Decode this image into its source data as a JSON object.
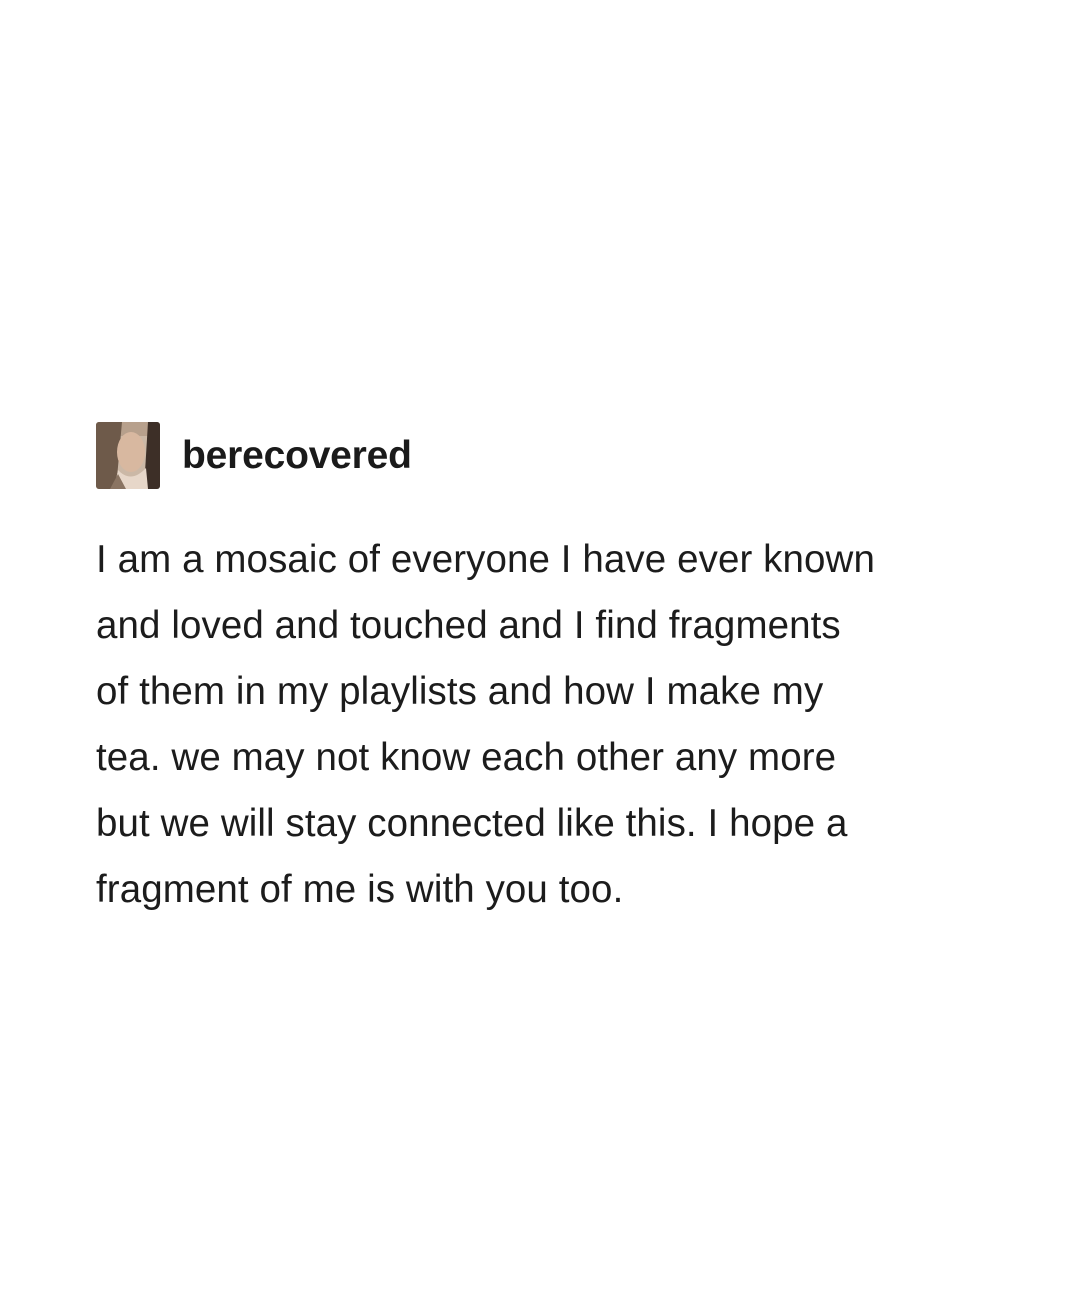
{
  "post": {
    "username": "berecovered",
    "avatar": "avatar-photo",
    "body_lines": [
      "I am a mosaic of everyone I have ever known",
      "and loved and touched and I find fragments",
      "of them in my playlists and how I make my",
      "tea. we may not know each other any more",
      "but we will stay connected like this. I hope a",
      "fragment of me is with you too."
    ]
  }
}
